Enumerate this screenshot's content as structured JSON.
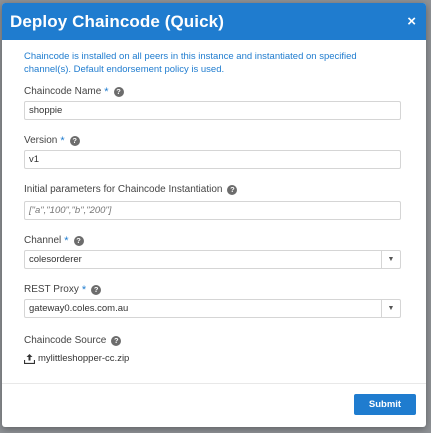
{
  "modal": {
    "title": "Deploy Chaincode (Quick)",
    "close_label": "×",
    "info": "Chaincode is installed on all peers in this instance and instantiated on specified channel(s). Default endorsement policy is used."
  },
  "fields": {
    "chaincode_name": {
      "label": "Chaincode Name",
      "value": "shoppie"
    },
    "version": {
      "label": "Version",
      "value": "v1"
    },
    "init_params": {
      "label": "Initial parameters for Chaincode Instantiation",
      "placeholder": "[\"a\",\"100\",\"b\",\"200\"]"
    },
    "channel": {
      "label": "Channel",
      "value": "colesorderer"
    },
    "rest_proxy": {
      "label": "REST Proxy",
      "value": "gateway0.coles.com.au"
    },
    "chaincode_source": {
      "label": "Chaincode Source",
      "file": "mylittleshopper-cc.zip"
    }
  },
  "submit_label": "Submit",
  "icons": {
    "help": "help-icon",
    "upload": "upload-icon",
    "caret": "caret-down-icon",
    "close": "close-icon"
  },
  "colors": {
    "accent": "#1f7ccf"
  }
}
